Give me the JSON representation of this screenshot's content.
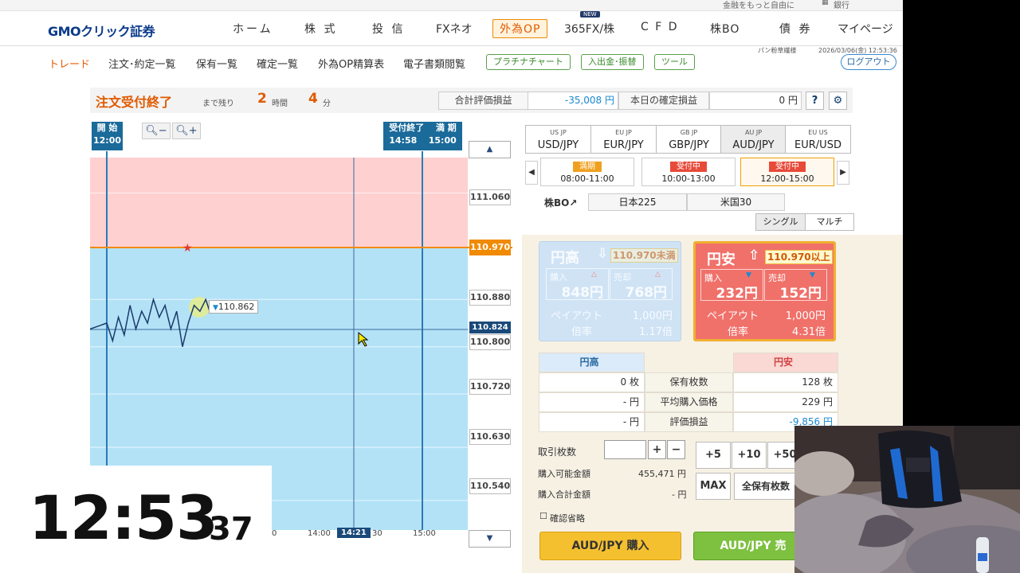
{
  "topstrip": {
    "tagline": "金融をもっと自由に",
    "bank": "銀行"
  },
  "header": {
    "logo": "GMOクリック証券",
    "new_badge": "NEW",
    "nav": [
      "ホーム",
      "株 式",
      "投 信",
      "FXネオ",
      "外為OP",
      "365FX/株",
      "C F D",
      "株BO",
      "債 券",
      "マイページ"
    ]
  },
  "subnav": {
    "items": [
      "トレード",
      "注文･約定一覧",
      "保有一覧",
      "確定一覧",
      "外為OP精算表",
      "電子書類閲覧"
    ],
    "buttons": [
      "プラチナチャート",
      "入出金･振替",
      "ツール"
    ],
    "username": "パン粉草繊様",
    "datetime": "2026/03/06(金) 12:53:36",
    "logout": "ログアウト"
  },
  "status": {
    "title": "注文受付終了",
    "remaining_label": "まで残り",
    "hours": "2",
    "hours_unit": "時間",
    "minutes": "4",
    "minutes_unit": "分",
    "total_eval_label": "合計評価損益",
    "total_eval_value": "-35,008 円",
    "today_label": "本日の確定損益",
    "today_value": "0 円",
    "help": "?",
    "gear_icon": "gear-icon"
  },
  "chart": {
    "zoom_out": "−",
    "zoom_in": "+",
    "start_label": "開 始",
    "start_time": "12:00",
    "close_label": "受付終了",
    "close_time": "14:58",
    "expiry_label": "満 期",
    "expiry_time": "15:00",
    "y_ticks": [
      "111.060",
      "110.880",
      "110.800",
      "110.720",
      "110.630",
      "110.540"
    ],
    "strike": "110.970",
    "current": "110.824",
    "price_tag": "110.862",
    "x_ticks": [
      "14:00",
      "30",
      "15:00"
    ],
    "x_partial": "0",
    "x_current": "14:21",
    "up": "▲",
    "down": "▼"
  },
  "chart_data": {
    "type": "line",
    "x": [
      "12:00",
      "12:03",
      "12:06",
      "12:09",
      "12:12",
      "12:15",
      "12:18",
      "12:21",
      "12:24",
      "12:27",
      "12:30",
      "12:33",
      "12:36",
      "12:39",
      "12:42",
      "12:45",
      "12:48",
      "12:51",
      "12:53"
    ],
    "y": [
      110.84,
      110.81,
      110.85,
      110.82,
      110.87,
      110.83,
      110.86,
      110.84,
      110.88,
      110.85,
      110.87,
      110.83,
      110.86,
      110.8,
      110.84,
      110.87,
      110.86,
      110.88,
      110.86
    ],
    "ylim": [
      110.49,
      111.12
    ],
    "strike": 110.97,
    "current": 110.824,
    "xlim": [
      "12:00",
      "15:06"
    ]
  },
  "pairs": [
    {
      "label": "USD/JPY",
      "flags": "US JP"
    },
    {
      "label": "EUR/JPY",
      "flags": "EU JP"
    },
    {
      "label": "GBP/JPY",
      "flags": "GB JP"
    },
    {
      "label": "AUD/JPY",
      "flags": "AU JP"
    },
    {
      "label": "EUR/USD",
      "flags": "EU US"
    }
  ],
  "sessions": [
    {
      "status": "満期",
      "range": "08:00-11:00",
      "color": "#f0a020"
    },
    {
      "status": "受付中",
      "range": "10:00-13:00",
      "color": "#e84a3a"
    },
    {
      "status": "受付中",
      "range": "12:00-15:00",
      "color": "#e84a3a"
    }
  ],
  "kabubo": {
    "label": "株BO↗",
    "items": [
      "日本225",
      "米国30"
    ]
  },
  "modes": [
    "シングル",
    "マルチ"
  ],
  "cards": {
    "high": {
      "name": "円高",
      "arrow": "⇩",
      "strike": "110.970未満",
      "buy_label": "購入",
      "sell_label": "売却",
      "buy": "848円",
      "sell": "768円",
      "payout_label": "ペイアウト",
      "payout": "1,000円",
      "ratio_label": "倍率",
      "ratio": "1.17倍"
    },
    "low": {
      "name": "円安",
      "arrow": "⇧",
      "strike": "110.970以上",
      "buy_label": "購入",
      "sell_label": "売却",
      "buy": "232円",
      "sell": "152円",
      "payout_label": "ペイアウト",
      "payout": "1,000円",
      "ratio_label": "倍率",
      "ratio": "4.31倍"
    }
  },
  "holdings": {
    "col_left": "円高",
    "col_right": "円安",
    "rows": [
      {
        "left": "0 枚",
        "label": "保有枚数",
        "right": "128 枚"
      },
      {
        "left": "- 円",
        "label": "平均購入価格",
        "right": "229 円"
      },
      {
        "left": "- 円",
        "label": "評価損益",
        "right": "-9,856 円"
      }
    ]
  },
  "order": {
    "qty_label": "取引枚数",
    "plus": "+",
    "minus": "−",
    "available_label": "購入可能金額",
    "available": "455,471 円",
    "total_label": "購入合計金額",
    "total": "- 円",
    "steps": [
      "+5",
      "+10",
      "+50"
    ],
    "max": "MAX",
    "all": "全保有枚数",
    "skip_confirm": "確認省略",
    "buy_btn": "AUD/JPY 購入",
    "sell_btn": "AUD/JPY 売"
  },
  "clock": {
    "hm": "12:53",
    "s": "37"
  },
  "colors": {
    "accent": "#e05a00",
    "put_zone": "#ffd0d0",
    "call_zone": "#b3e2f7",
    "strike_line": "#f08a00",
    "line": "#1a3a6a"
  }
}
